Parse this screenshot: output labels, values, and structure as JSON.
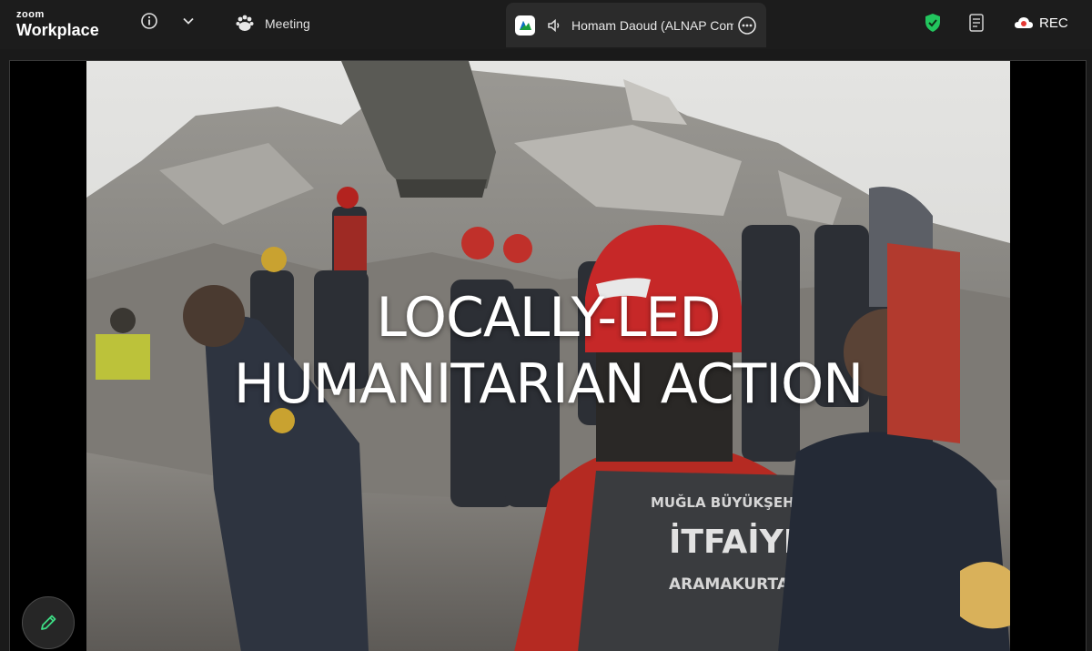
{
  "app": {
    "brand_top": "zoom",
    "brand_bottom": "Workplace"
  },
  "toolbar": {
    "meeting_label": "Meeting",
    "active_speaker": "Homam Daoud (ALNAP Com",
    "rec_label": "REC"
  },
  "icons": {
    "info": "info-icon",
    "chevron": "chevron-down-icon",
    "meeting": "paw-icon",
    "speaker_app": "zoom-app-logo-icon",
    "audio": "speaker-icon",
    "more": "more-icon",
    "security": "shield-icon",
    "notes": "notes-icon",
    "record": "cloud-record-icon",
    "annotate": "pencil-icon"
  },
  "slide": {
    "title_line1": "LOCALLY-LED",
    "title_line2": "HUMANITARIAN ACTION",
    "vest_line1": "MUĞLA BÜYÜKŞEHİR",
    "vest_line2": "İTFAİYESİ",
    "vest_line3": "ARAMAKURTARMA"
  },
  "colors": {
    "shield": "#22c55e",
    "pencil": "#3ddc84",
    "rec_dot": "#e53935",
    "helmet": "#c62828"
  }
}
